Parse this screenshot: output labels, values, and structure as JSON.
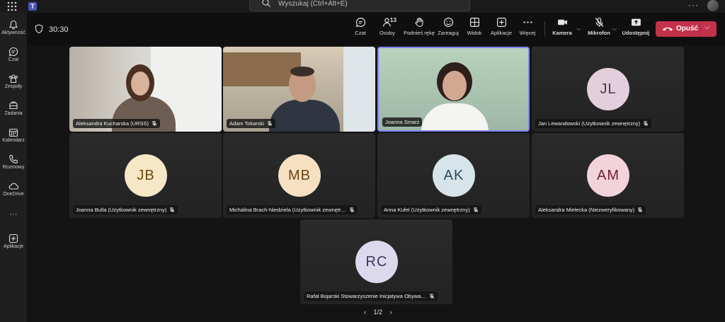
{
  "search": {
    "placeholder": "Wyszukaj (Ctrl+Alt+E)"
  },
  "titlebar": {
    "more": "···"
  },
  "rail": [
    {
      "label": "Aktywność",
      "icon": "bell-icon"
    },
    {
      "label": "Czat",
      "icon": "chat-icon"
    },
    {
      "label": "Zespoły",
      "icon": "teams-icon"
    },
    {
      "label": "Zadania",
      "icon": "tasks-icon"
    },
    {
      "label": "Kalendarz",
      "icon": "calendar-icon"
    },
    {
      "label": "Rozmowy",
      "icon": "phone-icon"
    },
    {
      "label": "OneDrive",
      "icon": "cloud-icon"
    },
    {
      "label": "···",
      "icon": "more-icon"
    },
    {
      "label": "Aplikacje",
      "icon": "add-icon"
    }
  ],
  "meeting": {
    "timer": "30:30",
    "controls": {
      "chat": "Czat",
      "people": "Osoby",
      "people_count": "13",
      "raise_hand": "Podnieś rękę",
      "react": "Zareaguj",
      "view": "Widok",
      "apps": "Aplikacje",
      "more": "Więcej",
      "camera": "Kamera",
      "mic": "Mikrofon",
      "share": "Udostępnij",
      "leave": "Opuść"
    }
  },
  "participants": [
    {
      "name": "Aleksandra Kucharska (URSS)",
      "muted": true,
      "type": "video"
    },
    {
      "name": "Adam Tokarski",
      "muted": true,
      "type": "video"
    },
    {
      "name": "Joanna Smarż",
      "muted": false,
      "type": "video",
      "active_speaker": true
    },
    {
      "name": "Jan Lewandowski (Użytkownik zewnętrzny)",
      "muted": true,
      "initials": "JL",
      "color": "#e3cedb",
      "text_color": "#5a2d4a"
    },
    {
      "name": "Joanna Bulla (Użytkownik zewnętrzny)",
      "muted": true,
      "initials": "JB",
      "color": "#f6e7c6",
      "text_color": "#6a4a12"
    },
    {
      "name": "Michalina Brach-Niedziela (Użytkownik zewnętr…",
      "muted": true,
      "initials": "MB",
      "color": "#f6e0c2",
      "text_color": "#6d4412"
    },
    {
      "name": "Anna Kufel (Użytkownik zewnętrzny)",
      "muted": true,
      "initials": "AK",
      "color": "#d7e4ea",
      "text_color": "#2a4a58"
    },
    {
      "name": "Aleksandra Mielecka (Niezweryfikowany)",
      "muted": true,
      "initials": "AM",
      "color": "#f3d3da",
      "text_color": "#6e2338"
    },
    {
      "name": "Rafał Bojarski Stowarzyszenie Inicjatywa Obywa…",
      "muted": true,
      "initials": "RC",
      "color": "#ddd9ec",
      "text_color": "#3d3566"
    }
  ],
  "pager": {
    "text": "1/2",
    "prev": "‹",
    "next": "›"
  }
}
